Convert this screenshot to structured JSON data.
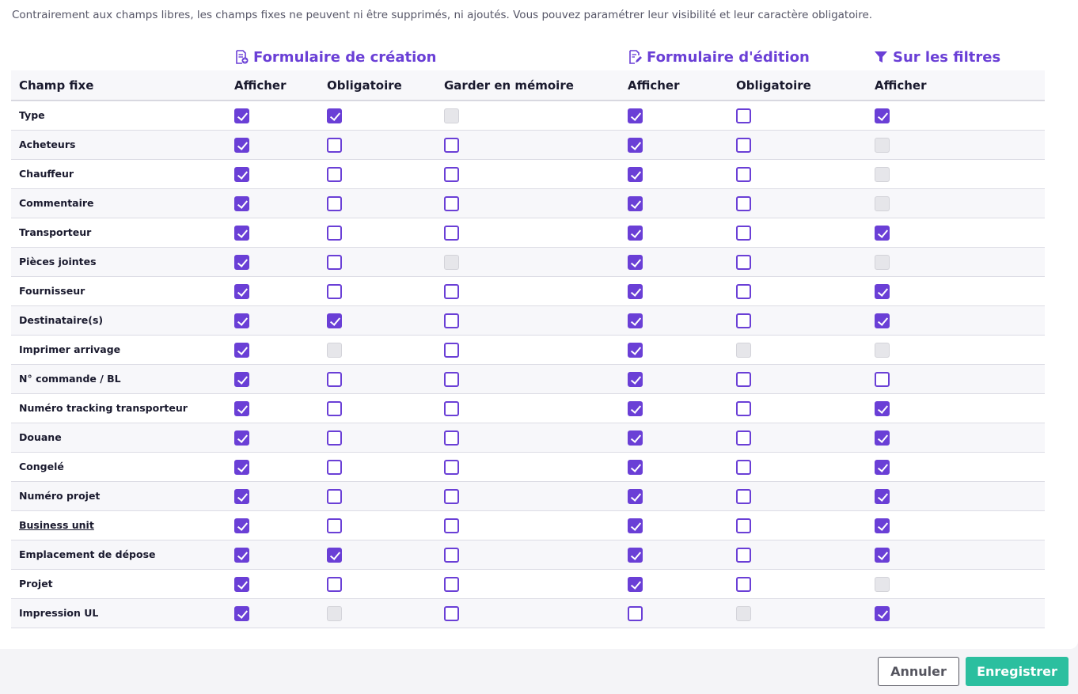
{
  "intro_text": "Contrairement aux champs libres, les champs fixes ne peuvent ni être supprimés, ni ajoutés. Vous pouvez paramétrer leur visibilité et leur caractère obligatoire.",
  "groups": {
    "creation": {
      "title": "Formulaire de création",
      "icon": "form-add-icon"
    },
    "edition": {
      "title": "Formulaire d'édition",
      "icon": "form-edit-icon"
    },
    "filters": {
      "title": "Sur les filtres",
      "icon": "filter-icon"
    }
  },
  "columns": {
    "field": "Champ fixe",
    "create_show": "Afficher",
    "create_required": "Obligatoire",
    "create_remember": "Garder en mémoire",
    "edit_show": "Afficher",
    "edit_required": "Obligatoire",
    "filter_show": "Afficher"
  },
  "checkbox_legend": {
    "on": "checked",
    "off": "unchecked",
    "dis": "disabled"
  },
  "colors": {
    "accent": "#6a3fd6",
    "save": "#2bbf9f",
    "disabled": "#e6e6ea"
  },
  "rows": [
    {
      "label": "Type",
      "states": [
        "on",
        "on",
        "dis",
        "on",
        "off",
        "on"
      ]
    },
    {
      "label": "Acheteurs",
      "states": [
        "on",
        "off",
        "off",
        "on",
        "off",
        "dis"
      ]
    },
    {
      "label": "Chauffeur",
      "states": [
        "on",
        "off",
        "off",
        "on",
        "off",
        "dis"
      ]
    },
    {
      "label": "Commentaire",
      "states": [
        "on",
        "off",
        "off",
        "on",
        "off",
        "dis"
      ]
    },
    {
      "label": "Transporteur",
      "states": [
        "on",
        "off",
        "off",
        "on",
        "off",
        "on"
      ]
    },
    {
      "label": "Pièces jointes",
      "states": [
        "on",
        "off",
        "dis",
        "on",
        "off",
        "dis"
      ]
    },
    {
      "label": "Fournisseur",
      "states": [
        "on",
        "off",
        "off",
        "on",
        "off",
        "on"
      ]
    },
    {
      "label": "Destinataire(s)",
      "states": [
        "on",
        "on",
        "off",
        "on",
        "off",
        "on"
      ]
    },
    {
      "label": "Imprimer arrivage",
      "states": [
        "on",
        "dis",
        "off",
        "on",
        "dis",
        "dis"
      ]
    },
    {
      "label": "N° commande / BL",
      "states": [
        "on",
        "off",
        "off",
        "on",
        "off",
        "off"
      ]
    },
    {
      "label": "Numéro tracking transporteur",
      "states": [
        "on",
        "off",
        "off",
        "on",
        "off",
        "on"
      ]
    },
    {
      "label": "Douane",
      "states": [
        "on",
        "off",
        "off",
        "on",
        "off",
        "on"
      ]
    },
    {
      "label": "Congelé",
      "states": [
        "on",
        "off",
        "off",
        "on",
        "off",
        "on"
      ]
    },
    {
      "label": "Numéro projet",
      "states": [
        "on",
        "off",
        "off",
        "on",
        "off",
        "on"
      ]
    },
    {
      "label": "Business unit",
      "underline": true,
      "states": [
        "on",
        "off",
        "off",
        "on",
        "off",
        "on"
      ]
    },
    {
      "label": "Emplacement de dépose",
      "states": [
        "on",
        "on",
        "off",
        "on",
        "off",
        "on"
      ]
    },
    {
      "label": "Projet",
      "states": [
        "on",
        "off",
        "off",
        "on",
        "off",
        "dis"
      ]
    },
    {
      "label": "Impression UL",
      "states": [
        "on",
        "dis",
        "off",
        "off",
        "dis",
        "on"
      ]
    }
  ],
  "buttons": {
    "cancel": "Annuler",
    "save": "Enregistrer"
  }
}
